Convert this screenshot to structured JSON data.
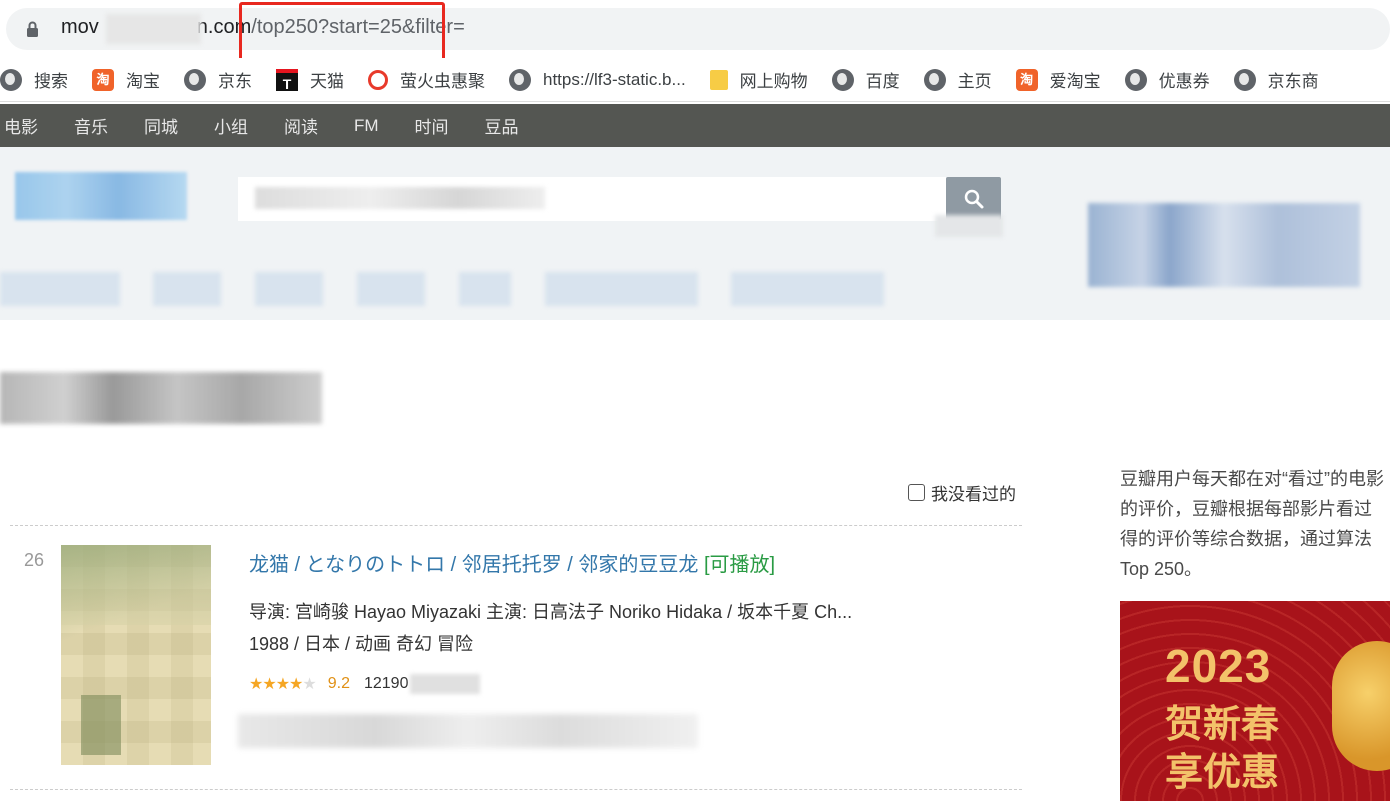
{
  "browser": {
    "url_prefix": "mov",
    "url_domain_tail": "n.com",
    "url_path": "/top250?start=25&filter="
  },
  "bookmarks": [
    {
      "label": "搜索",
      "icon": "globe-icon"
    },
    {
      "label": "淘宝",
      "icon": "taobao-icon"
    },
    {
      "label": "京东",
      "icon": "globe-icon"
    },
    {
      "label": "天猫",
      "icon": "tmall-icon"
    },
    {
      "label": "萤火虫惠聚",
      "icon": "ring-icon"
    },
    {
      "label": "https://lf3-static.b...",
      "icon": "globe-icon"
    },
    {
      "label": "网上购物",
      "icon": "folder-icon"
    },
    {
      "label": "百度",
      "icon": "globe-icon"
    },
    {
      "label": "主页",
      "icon": "globe-icon"
    },
    {
      "label": "爱淘宝",
      "icon": "taobao-icon"
    },
    {
      "label": "优惠券",
      "icon": "globe-icon"
    },
    {
      "label": "京东商",
      "icon": "globe-icon"
    }
  ],
  "topnav": [
    "电影",
    "音乐",
    "同城",
    "小组",
    "阅读",
    "FM",
    "时间",
    "豆品"
  ],
  "filter": {
    "label": "我没看过的"
  },
  "movie": {
    "rank": "26",
    "title": "龙猫",
    "title_alt": " / となりのトトロ",
    "title_other": " / 邻居托托罗 / 邻家的豆豆龙",
    "playable": "[可播放]",
    "credits": "导演: 宫崎骏 Hayao Miyazaki   主演: 日高法子 Noriko Hidaka / 坂本千夏 Ch...",
    "meta": "1988 / 日本 / 动画 奇幻 冒险",
    "rating": "9.2",
    "votes": "12190",
    "stars": 4.5
  },
  "sidebar": {
    "line1": "豆瓣用户每天都在对“看过”的电影",
    "line2": "的评价，豆瓣根据每部影片看过",
    "line3": "得的评价等综合数据，通过算法",
    "line4": "Top 250。",
    "banner_year": "2023",
    "banner_line1": "贺新春",
    "banner_line2": "享优惠"
  },
  "colors": {
    "nav_bg": "#545652",
    "link": "#3377aa",
    "playable": "#2a9b44",
    "score": "#e09015",
    "highlight_box": "#e8281f",
    "banner_bg": "#a8131a"
  }
}
